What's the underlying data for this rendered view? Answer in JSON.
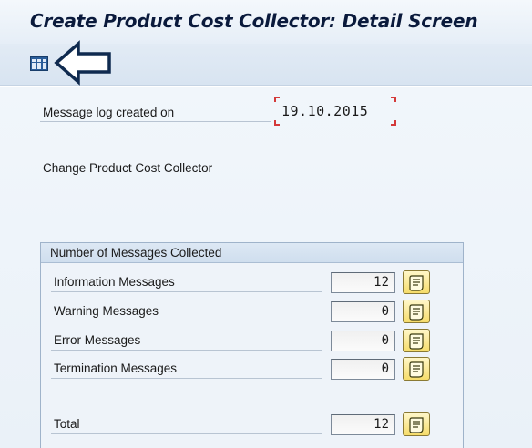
{
  "window": {
    "title": "Create Product Cost Collector: Detail Screen"
  },
  "toolbar": {
    "icon": "grid-icon"
  },
  "header_fields": {
    "created_label": "Message log created on",
    "created_date": "19.10.2015"
  },
  "description": "Change Product Cost Collector",
  "messages_group": {
    "title": "Number of Messages Collected",
    "rows": [
      {
        "label": "Information Messages",
        "value": "12"
      },
      {
        "label": "Warning Messages",
        "value": "0"
      },
      {
        "label": "Error Messages",
        "value": "0"
      },
      {
        "label": "Termination Messages",
        "value": "0"
      }
    ],
    "total": {
      "label": "Total",
      "value": "12"
    }
  },
  "colors": {
    "accent_required": "#d43a3a",
    "button_fill": "#f6dc6a",
    "title_text": "#0a1a3c"
  }
}
